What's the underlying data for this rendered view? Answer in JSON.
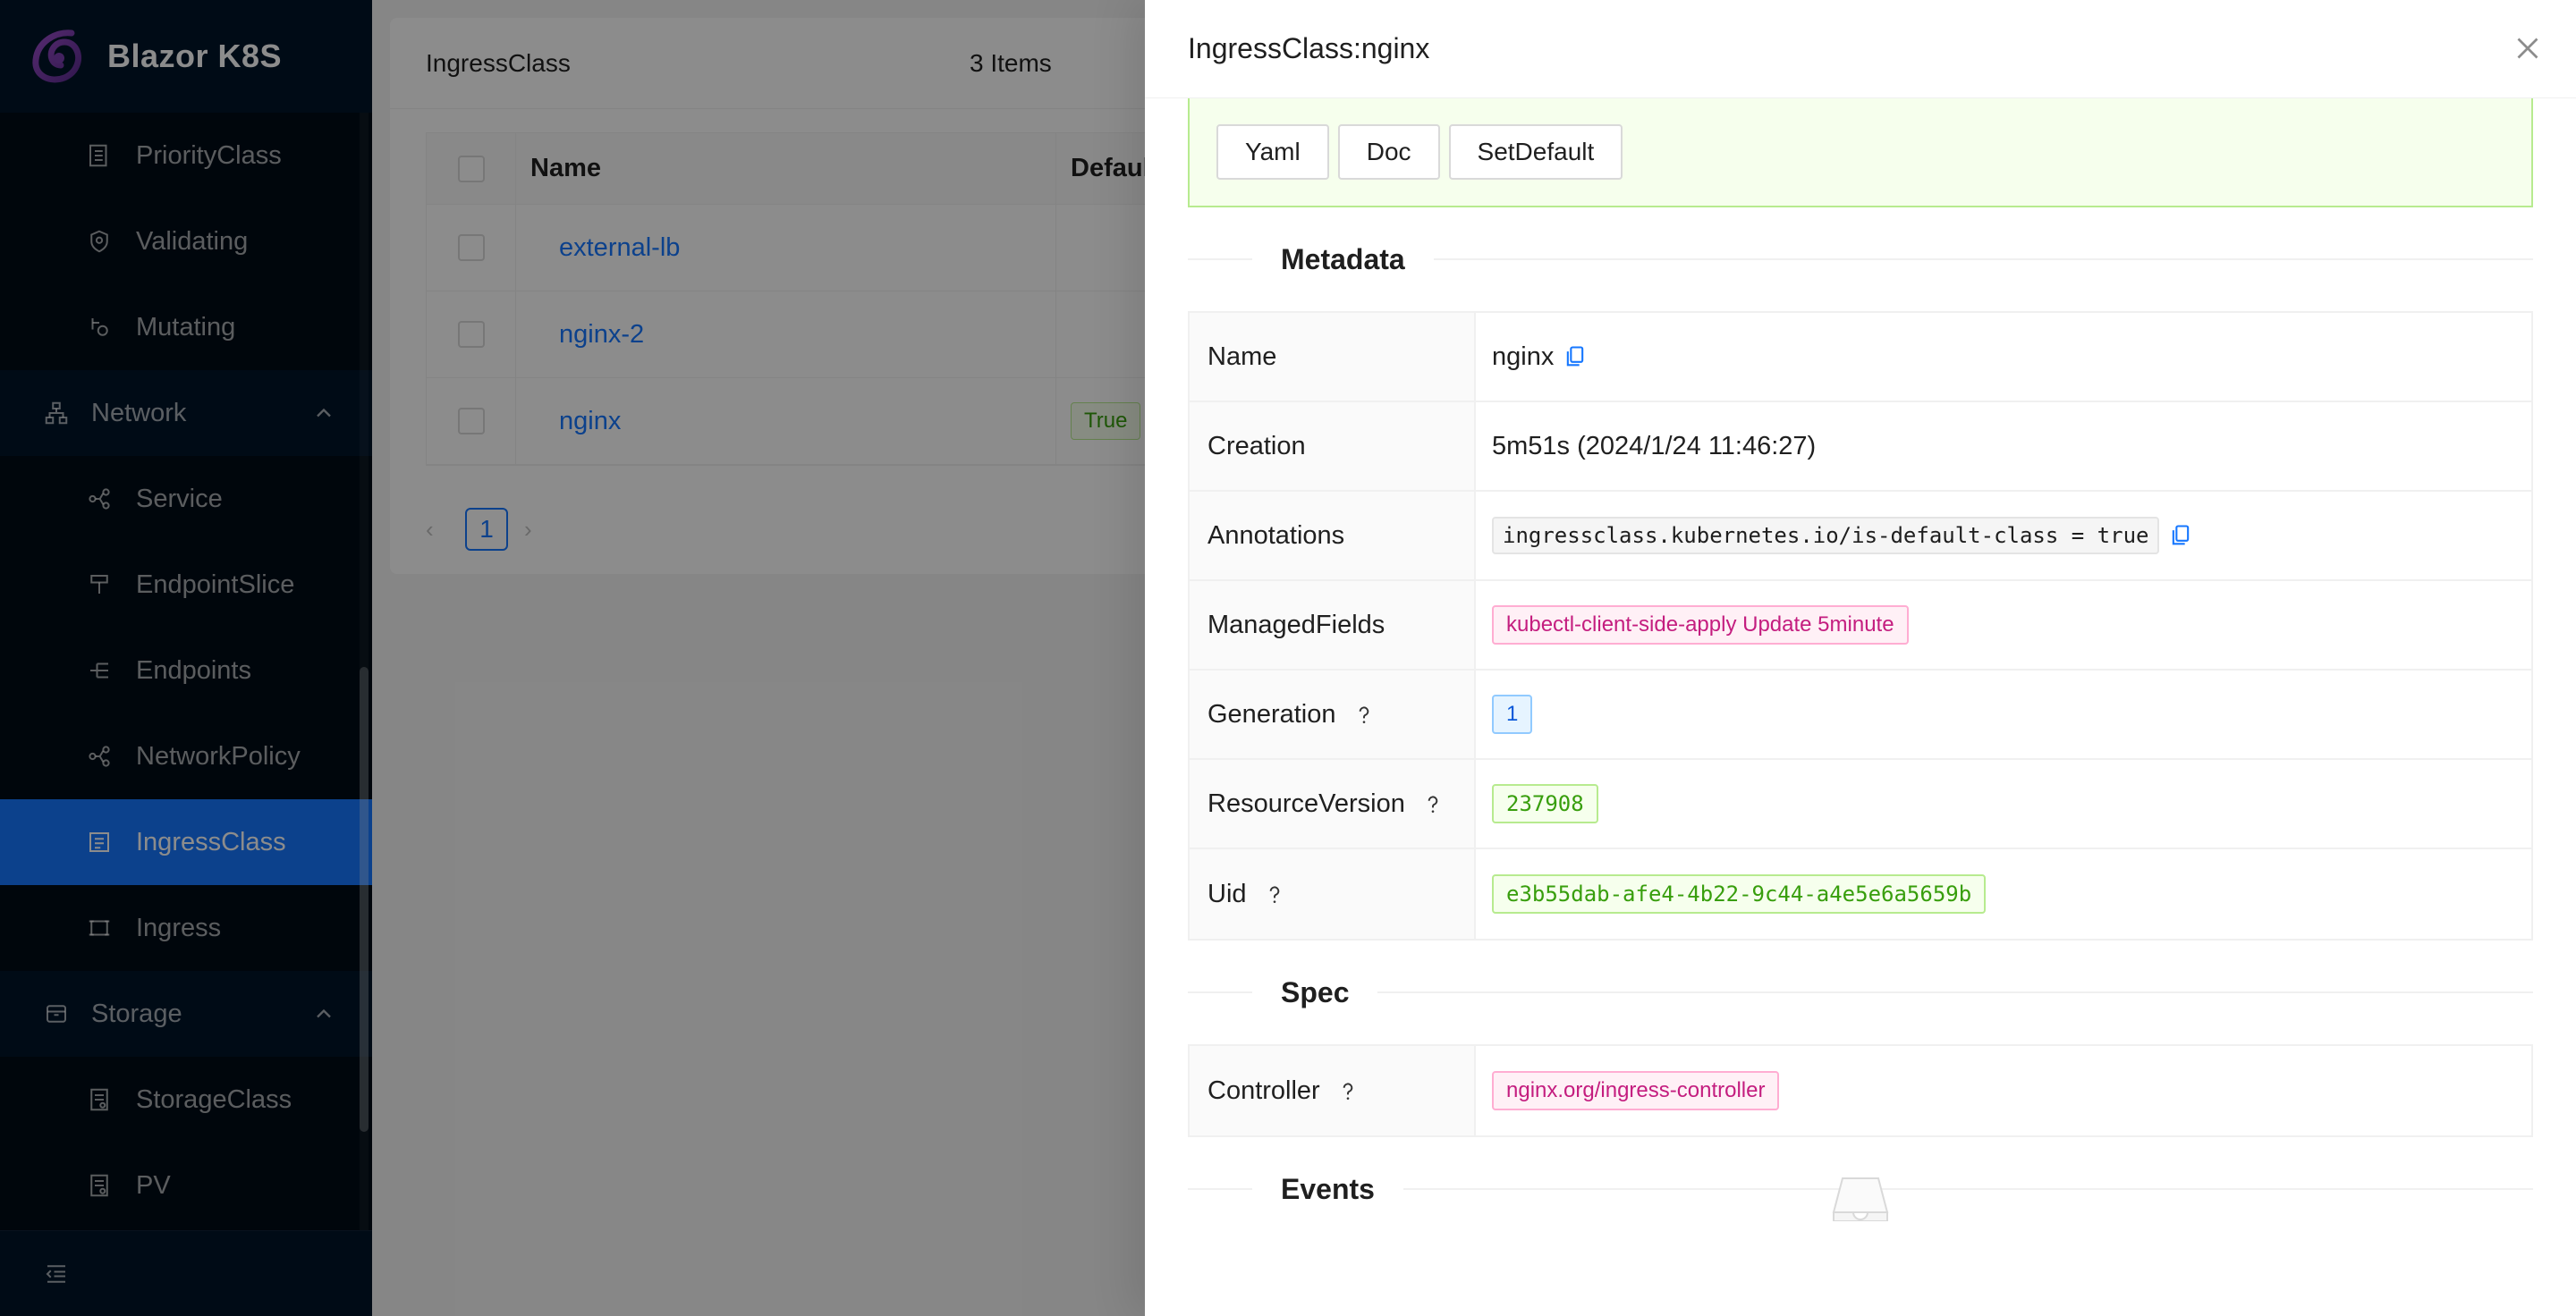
{
  "app": {
    "name": "Blazor K8S"
  },
  "sidebar": {
    "items_top": [
      {
        "label": "PriorityClass",
        "icon": "priorityclass-icon"
      },
      {
        "label": "Validating",
        "icon": "validating-icon"
      },
      {
        "label": "Mutating",
        "icon": "mutating-icon"
      }
    ],
    "network": {
      "label": "Network",
      "items": [
        {
          "label": "Service"
        },
        {
          "label": "EndpointSlice"
        },
        {
          "label": "Endpoints"
        },
        {
          "label": "NetworkPolicy"
        },
        {
          "label": "IngressClass",
          "active": true
        },
        {
          "label": "Ingress"
        }
      ]
    },
    "storage": {
      "label": "Storage",
      "items": [
        {
          "label": "StorageClass"
        },
        {
          "label": "PV"
        }
      ]
    }
  },
  "list": {
    "title": "IngressClass",
    "count": "3 Items",
    "columns": {
      "name": "Name",
      "default": "Default"
    },
    "rows": [
      {
        "name": "external-lb",
        "default": ""
      },
      {
        "name": "nginx-2",
        "default": ""
      },
      {
        "name": "nginx",
        "default": "True"
      }
    ],
    "page": "1"
  },
  "drawer": {
    "title": "IngressClass:nginx",
    "buttons": {
      "yaml": "Yaml",
      "doc": "Doc",
      "set_default": "SetDefault"
    },
    "metadata_title": "Metadata",
    "spec_title": "Spec",
    "events_title": "Events",
    "metadata": {
      "name_label": "Name",
      "name_value": "nginx",
      "creation_label": "Creation",
      "creation_value": "5m51s (2024/1/24 11:46:27)",
      "annotations_label": "Annotations",
      "annotations_value": "ingressclass.kubernetes.io/is-default-class = true",
      "managed_label": "ManagedFields",
      "managed_value": "kubectl-client-side-apply Update 5minute",
      "generation_label": "Generation",
      "generation_value": "1",
      "rv_label": "ResourceVersion",
      "rv_value": "237908",
      "uid_label": "Uid",
      "uid_value": "e3b55dab-afe4-4b22-9c44-a4e5e6a5659b"
    },
    "spec": {
      "controller_label": "Controller",
      "controller_value": "nginx.org/ingress-controller"
    }
  },
  "colors": {
    "primary": "#1677ff",
    "sider": "#001529",
    "success_bg": "#f6ffed"
  }
}
